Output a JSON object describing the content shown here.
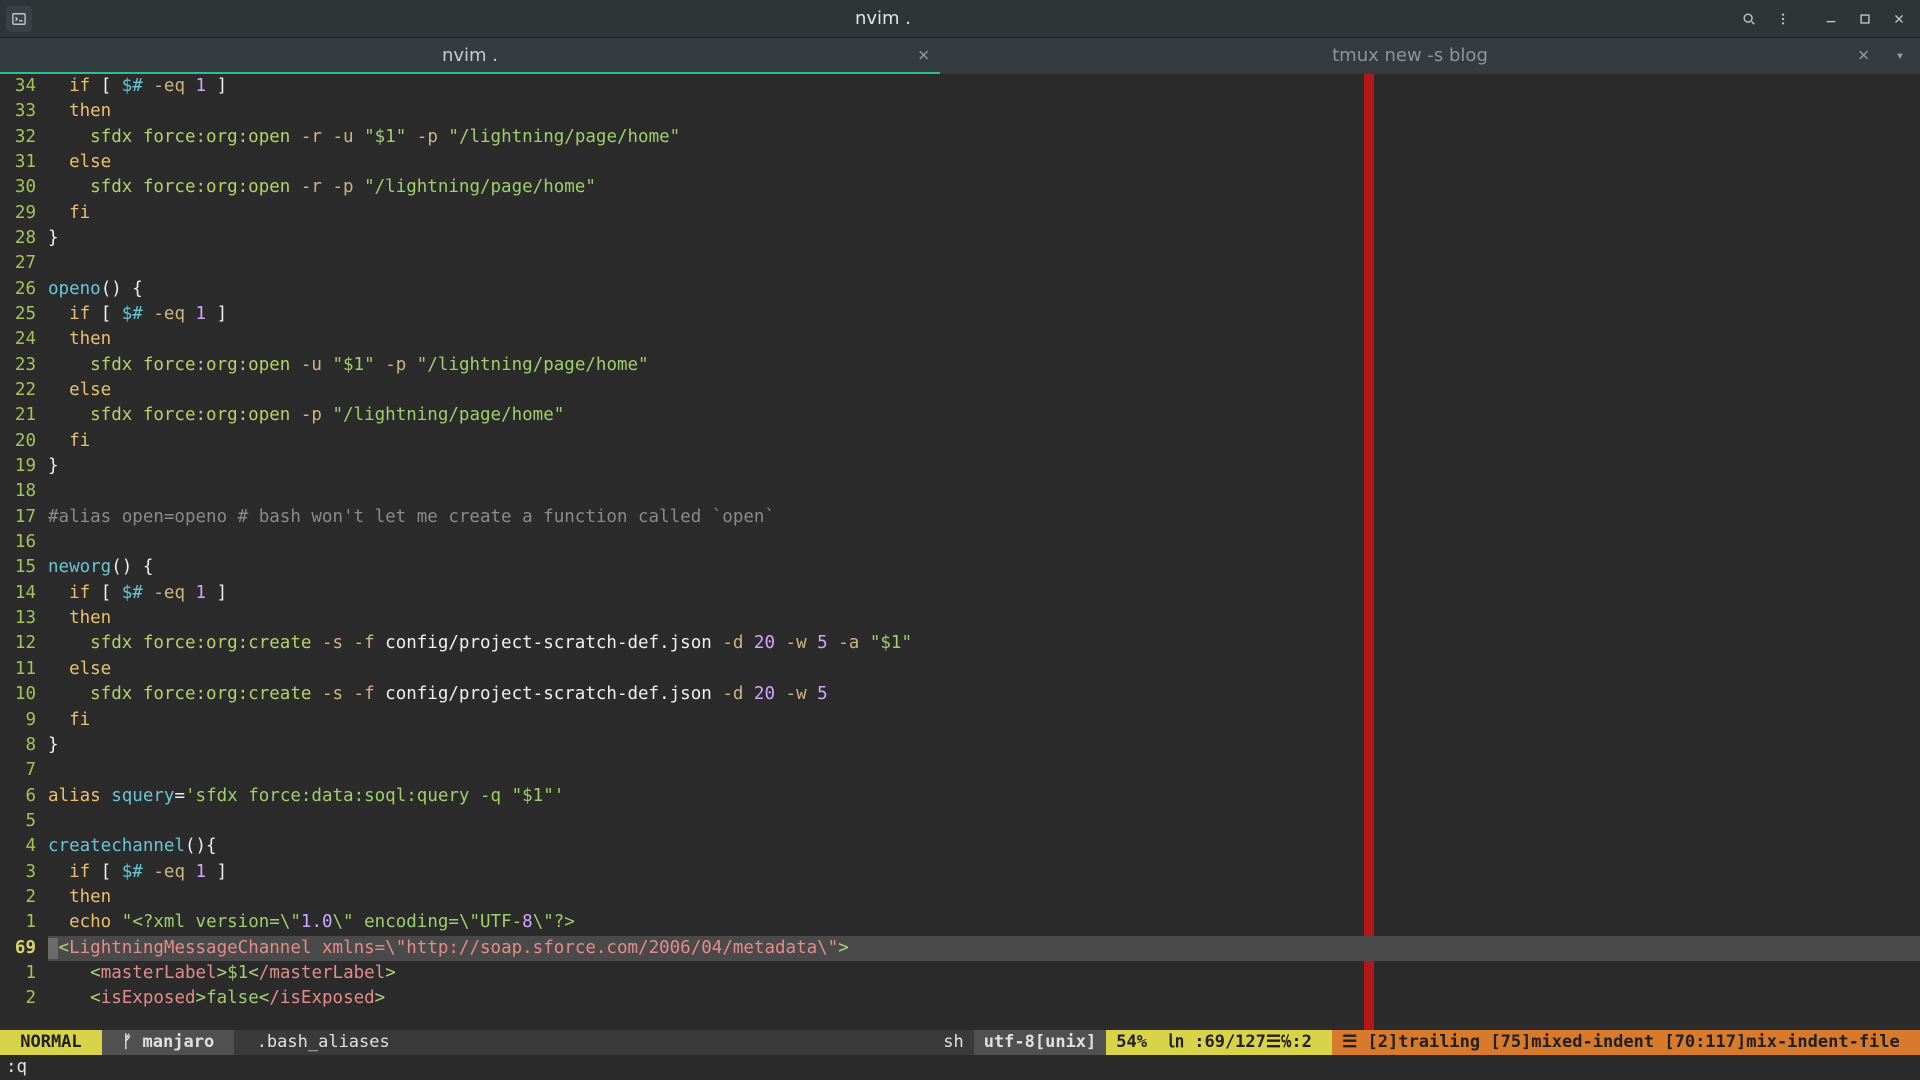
{
  "window": {
    "title": "nvim ."
  },
  "tabs": [
    {
      "label": "nvim .",
      "active": true
    },
    {
      "label": "tmux new -s blog",
      "active": false
    }
  ],
  "gutter": [
    {
      "n": "34"
    },
    {
      "n": "33"
    },
    {
      "n": "32"
    },
    {
      "n": "31"
    },
    {
      "n": "30"
    },
    {
      "n": "29"
    },
    {
      "n": "28"
    },
    {
      "n": "27"
    },
    {
      "n": "26"
    },
    {
      "n": "25"
    },
    {
      "n": "24"
    },
    {
      "n": "23"
    },
    {
      "n": "22"
    },
    {
      "n": "21"
    },
    {
      "n": "20"
    },
    {
      "n": "19"
    },
    {
      "n": "18"
    },
    {
      "n": "17"
    },
    {
      "n": "16"
    },
    {
      "n": "15"
    },
    {
      "n": "14"
    },
    {
      "n": "13"
    },
    {
      "n": "12"
    },
    {
      "n": "11"
    },
    {
      "n": "10"
    },
    {
      "n": "9"
    },
    {
      "n": "8"
    },
    {
      "n": "7"
    },
    {
      "n": "6"
    },
    {
      "n": "5"
    },
    {
      "n": "4"
    },
    {
      "n": "3"
    },
    {
      "n": "2"
    },
    {
      "n": "1"
    },
    {
      "n": "69",
      "cursor": true
    },
    {
      "n": "1"
    },
    {
      "n": "2"
    }
  ],
  "code": [
    [
      [
        "  ",
        "plain"
      ],
      [
        "if",
        "kw"
      ],
      [
        " [ ",
        "plain"
      ],
      [
        "$#",
        "builtin"
      ],
      [
        " ",
        "plain"
      ],
      [
        "-eq",
        "opt"
      ],
      [
        " ",
        "plain"
      ],
      [
        "1",
        "num"
      ],
      [
        " ]",
        "plain"
      ]
    ],
    [
      [
        "  ",
        "plain"
      ],
      [
        "then",
        "kw"
      ]
    ],
    [
      [
        "    sfdx force:org:open ",
        "cmd"
      ],
      [
        "-r -u ",
        "opt"
      ],
      [
        "\"$1\"",
        "str"
      ],
      [
        " ",
        "plain"
      ],
      [
        "-p ",
        "opt"
      ],
      [
        "\"/lightning/page/home\"",
        "str"
      ]
    ],
    [
      [
        "  ",
        "plain"
      ],
      [
        "else",
        "kw"
      ]
    ],
    [
      [
        "    sfdx force:org:open ",
        "cmd"
      ],
      [
        "-r -p ",
        "opt"
      ],
      [
        "\"/lightning/page/home\"",
        "str"
      ]
    ],
    [
      [
        "  ",
        "plain"
      ],
      [
        "fi",
        "kw"
      ]
    ],
    [
      [
        "}",
        "punc"
      ]
    ],
    [
      [
        "",
        "plain"
      ]
    ],
    [
      [
        "openo",
        "builtin"
      ],
      [
        "()",
        "punc"
      ],
      [
        " {",
        "punc"
      ]
    ],
    [
      [
        "  ",
        "plain"
      ],
      [
        "if",
        "kw"
      ],
      [
        " [ ",
        "plain"
      ],
      [
        "$#",
        "builtin"
      ],
      [
        " ",
        "plain"
      ],
      [
        "-eq",
        "opt"
      ],
      [
        " ",
        "plain"
      ],
      [
        "1",
        "num"
      ],
      [
        " ]",
        "plain"
      ]
    ],
    [
      [
        "  ",
        "plain"
      ],
      [
        "then",
        "kw"
      ]
    ],
    [
      [
        "    sfdx force:org:open ",
        "cmd"
      ],
      [
        "-u ",
        "opt"
      ],
      [
        "\"$1\"",
        "str"
      ],
      [
        " ",
        "plain"
      ],
      [
        "-p ",
        "opt"
      ],
      [
        "\"/lightning/page/home\"",
        "str"
      ]
    ],
    [
      [
        "  ",
        "plain"
      ],
      [
        "else",
        "kw"
      ]
    ],
    [
      [
        "    sfdx force:org:open ",
        "cmd"
      ],
      [
        "-p ",
        "opt"
      ],
      [
        "\"/lightning/page/home\"",
        "str"
      ]
    ],
    [
      [
        "  ",
        "plain"
      ],
      [
        "fi",
        "kw"
      ]
    ],
    [
      [
        "}",
        "punc"
      ]
    ],
    [
      [
        "",
        "plain"
      ]
    ],
    [
      [
        "#alias open=openo # bash won't let me create a function called `open`",
        "cmt"
      ]
    ],
    [
      [
        "",
        "plain"
      ]
    ],
    [
      [
        "neworg",
        "builtin"
      ],
      [
        "()",
        "punc"
      ],
      [
        " {",
        "punc"
      ]
    ],
    [
      [
        "  ",
        "plain"
      ],
      [
        "if",
        "kw"
      ],
      [
        " [ ",
        "plain"
      ],
      [
        "$#",
        "builtin"
      ],
      [
        " ",
        "plain"
      ],
      [
        "-eq",
        "opt"
      ],
      [
        " ",
        "plain"
      ],
      [
        "1",
        "num"
      ],
      [
        " ]",
        "plain"
      ]
    ],
    [
      [
        "  ",
        "plain"
      ],
      [
        "then",
        "kw"
      ]
    ],
    [
      [
        "    sfdx force:org:create ",
        "cmd"
      ],
      [
        "-s -f ",
        "opt"
      ],
      [
        "config/project-scratch-def.json ",
        "plain"
      ],
      [
        "-d ",
        "opt"
      ],
      [
        "20",
        "num"
      ],
      [
        " ",
        "plain"
      ],
      [
        "-w ",
        "opt"
      ],
      [
        "5",
        "num"
      ],
      [
        " ",
        "plain"
      ],
      [
        "-a ",
        "opt"
      ],
      [
        "\"$1\"",
        "str"
      ]
    ],
    [
      [
        "  ",
        "plain"
      ],
      [
        "else",
        "kw"
      ]
    ],
    [
      [
        "    sfdx force:org:create ",
        "cmd"
      ],
      [
        "-s -f ",
        "opt"
      ],
      [
        "config/project-scratch-def.json ",
        "plain"
      ],
      [
        "-d ",
        "opt"
      ],
      [
        "20",
        "num"
      ],
      [
        " ",
        "plain"
      ],
      [
        "-w ",
        "opt"
      ],
      [
        "5",
        "num"
      ]
    ],
    [
      [
        "  ",
        "plain"
      ],
      [
        "fi",
        "kw"
      ]
    ],
    [
      [
        "}",
        "punc"
      ]
    ],
    [
      [
        "",
        "plain"
      ]
    ],
    [
      [
        "alias",
        "kw"
      ],
      [
        " ",
        "plain"
      ],
      [
        "squery",
        "builtin"
      ],
      [
        "=",
        "plain"
      ],
      [
        "'sfdx force:data:soql:query -q \"$1\"'",
        "str"
      ]
    ],
    [
      [
        "",
        "plain"
      ]
    ],
    [
      [
        "createchannel",
        "builtin"
      ],
      [
        "()",
        "punc"
      ],
      [
        "{",
        "punc"
      ]
    ],
    [
      [
        "  ",
        "plain"
      ],
      [
        "if",
        "kw"
      ],
      [
        " [ ",
        "plain"
      ],
      [
        "$#",
        "builtin"
      ],
      [
        " ",
        "plain"
      ],
      [
        "-eq",
        "opt"
      ],
      [
        " ",
        "plain"
      ],
      [
        "1",
        "num"
      ],
      [
        " ]",
        "plain"
      ]
    ],
    [
      [
        "  ",
        "plain"
      ],
      [
        "then",
        "kw"
      ]
    ],
    [
      [
        "  ",
        "plain"
      ],
      [
        "echo",
        "kw"
      ],
      [
        " ",
        "plain"
      ],
      [
        "\"<?xml version=\\\"",
        "str"
      ],
      [
        "1.0",
        "num"
      ],
      [
        "\\\" encoding=\\\"UTF-",
        "str"
      ],
      [
        "8",
        "num"
      ],
      [
        "\\\"?>",
        "str"
      ]
    ],
    [
      [
        " ",
        "plain"
      ],
      [
        "<",
        "tagbr"
      ],
      [
        "LightningMessageChannel xmlns=\\\"http://soap.sforce.com/2006/04/metadata\\\"",
        "red"
      ],
      [
        ">",
        "tagbr"
      ]
    ],
    [
      [
        "    ",
        "plain"
      ],
      [
        "<",
        "tagbr"
      ],
      [
        "masterLabel",
        "red"
      ],
      [
        ">",
        "tagbr"
      ],
      [
        "$1",
        "str"
      ],
      [
        "<",
        "tagbr"
      ],
      [
        "/masterLabel",
        "red"
      ],
      [
        ">",
        "tagbr"
      ]
    ],
    [
      [
        "    ",
        "plain"
      ],
      [
        "<",
        "tagbr"
      ],
      [
        "isExposed",
        "red"
      ],
      [
        ">",
        "tagbr"
      ],
      [
        "false",
        "str"
      ],
      [
        "<",
        "tagbr"
      ],
      [
        "/isExposed",
        "red"
      ],
      [
        ">",
        "tagbr"
      ]
    ]
  ],
  "cursor_line_index": 34,
  "status": {
    "mode": " NORMAL ",
    "branch": " ᚠ manjaro ",
    "file": " .bash_aliases",
    "filetype": "sh",
    "encoding": "utf-8[unix]",
    "percent": "54%",
    "pos": "㏑ :69/127☰℅:2 ",
    "warn_sym": "☰",
    "warn": " [2]trailing [75]mixed-indent [70:117]mix-indent-file "
  },
  "cmd": ":q"
}
